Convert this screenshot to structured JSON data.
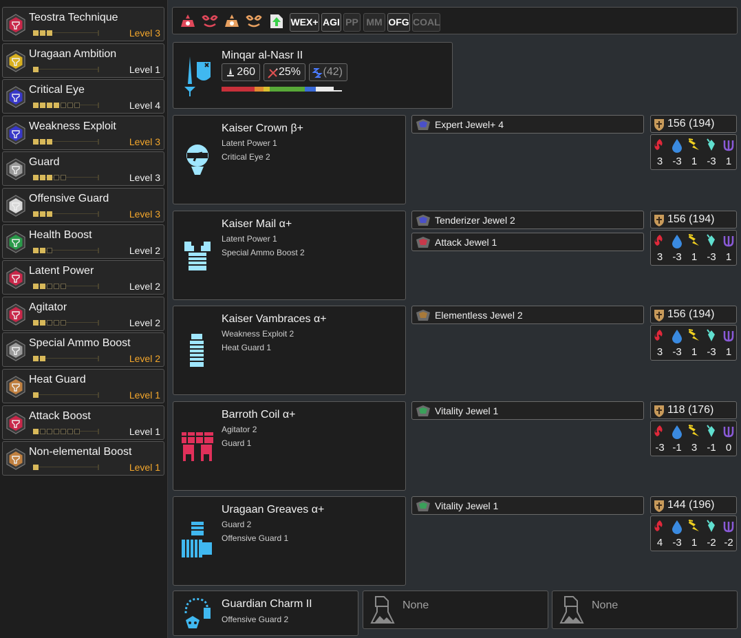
{
  "skills": [
    {
      "name": "Teostra Technique",
      "level": "Level 3",
      "max": true,
      "pips": 3,
      "total": 3,
      "color": "#c8284a"
    },
    {
      "name": "Uragaan Ambition",
      "level": "Level 1",
      "max": false,
      "pips": 1,
      "total": 1,
      "color": "#d8b020"
    },
    {
      "name": "Critical Eye",
      "level": "Level 4",
      "max": false,
      "pips": 4,
      "total": 7,
      "color": "#3838c8"
    },
    {
      "name": "Weakness Exploit",
      "level": "Level 3",
      "max": true,
      "pips": 3,
      "total": 3,
      "color": "#3838c8"
    },
    {
      "name": "Guard",
      "level": "Level 3",
      "max": false,
      "pips": 3,
      "total": 5,
      "color": "#9a9a9a"
    },
    {
      "name": "Offensive Guard",
      "level": "Level 3",
      "max": true,
      "pips": 3,
      "total": 3,
      "color": "#d8d8d8"
    },
    {
      "name": "Health Boost",
      "level": "Level 2",
      "max": false,
      "pips": 2,
      "total": 3,
      "color": "#2a9a4a"
    },
    {
      "name": "Latent Power",
      "level": "Level 2",
      "max": false,
      "pips": 2,
      "total": 5,
      "color": "#c8284a"
    },
    {
      "name": "Agitator",
      "level": "Level 2",
      "max": false,
      "pips": 2,
      "total": 5,
      "color": "#c8284a"
    },
    {
      "name": "Special Ammo Boost",
      "level": "Level 2",
      "max": true,
      "pips": 2,
      "total": 2,
      "color": "#9a9a9a"
    },
    {
      "name": "Heat Guard",
      "level": "Level 1",
      "max": true,
      "pips": 1,
      "total": 1,
      "color": "#c08040"
    },
    {
      "name": "Attack Boost",
      "level": "Level 1",
      "max": false,
      "pips": 1,
      "total": 7,
      "color": "#c8284a"
    },
    {
      "name": "Non-elemental Boost",
      "level": "Level 1",
      "max": true,
      "pips": 1,
      "total": 1,
      "color": "#c08040"
    }
  ],
  "toolbar": {
    "buttons": [
      {
        "label": "WEX+",
        "active": true
      },
      {
        "label": "AGI",
        "active": true
      },
      {
        "label": "PP",
        "active": false
      },
      {
        "label": "MM",
        "active": false
      },
      {
        "label": "OFG",
        "active": true
      },
      {
        "label": "COAL",
        "active": false
      }
    ]
  },
  "weapon": {
    "name": "Minqar al-Nasr II",
    "attack": "260",
    "affinity": "25%",
    "element": "(42)",
    "sharpness_colors": [
      "#c8303a",
      "#c8303a",
      "#e08a30",
      "#d8c030",
      "#58a838",
      "#3a6ad8",
      "#eaeaea"
    ]
  },
  "armor": [
    {
      "name": "Kaiser Crown β+",
      "skills": [
        "Latent Power 1",
        "Critical Eye 2"
      ],
      "jewels": [
        {
          "name": "Expert Jewel+ 4",
          "color": "#4a50c8"
        }
      ],
      "defense": "156  (194)",
      "res": [
        "3",
        "-3",
        "1",
        "-3",
        "1"
      ],
      "color": "#9fe6ff"
    },
    {
      "name": "Kaiser Mail α+",
      "skills": [
        "Latent Power 1",
        "Special Ammo Boost 2"
      ],
      "jewels": [
        {
          "name": "Tenderizer Jewel 2",
          "color": "#4a50c8"
        },
        {
          "name": "Attack Jewel 1",
          "color": "#c8384a"
        }
      ],
      "defense": "156  (194)",
      "res": [
        "3",
        "-3",
        "1",
        "-3",
        "1"
      ],
      "color": "#9fe6ff"
    },
    {
      "name": "Kaiser Vambraces α+",
      "skills": [
        "Weakness Exploit 2",
        "Heat Guard 1"
      ],
      "jewels": [
        {
          "name": "Elementless Jewel 2",
          "color": "#a87a3a"
        }
      ],
      "defense": "156  (194)",
      "res": [
        "3",
        "-3",
        "1",
        "-3",
        "1"
      ],
      "color": "#9fe6ff"
    },
    {
      "name": "Barroth Coil α+",
      "skills": [
        "Agitator 2",
        "Guard 1"
      ],
      "jewels": [
        {
          "name": "Vitality Jewel 1",
          "color": "#3aa05a"
        }
      ],
      "defense": "118  (176)",
      "res": [
        "-3",
        "-1",
        "3",
        "-1",
        "0"
      ],
      "color": "#e0305a"
    },
    {
      "name": "Uragaan Greaves α+",
      "skills": [
        "Guard 2",
        "Offensive Guard 1"
      ],
      "jewels": [
        {
          "name": "Vitality Jewel 1",
          "color": "#3aa05a"
        }
      ],
      "defense": "144  (196)",
      "res": [
        "4",
        "-3",
        "1",
        "-2",
        "-2"
      ],
      "color": "#40b8f0"
    }
  ],
  "charm": {
    "name": "Guardian Charm II",
    "skills": [
      "Offensive Guard 2"
    ]
  },
  "empty_slots": [
    "None",
    "None"
  ]
}
